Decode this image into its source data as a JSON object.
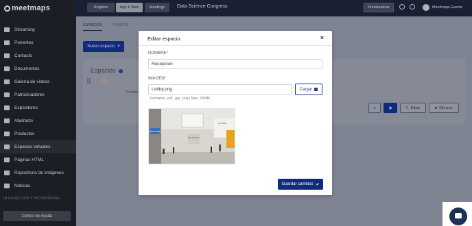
{
  "sidebar": {
    "logo": "meetmaps",
    "items": [
      {
        "label": "Streaming",
        "icon": "monitor-icon"
      },
      {
        "label": "Ponentes",
        "icon": "microphone-icon"
      },
      {
        "label": "Contacto",
        "icon": "phone-icon"
      },
      {
        "label": "Documentos",
        "icon": "paperclip-icon"
      },
      {
        "label": "Galería de vídeos",
        "icon": "video-icon"
      },
      {
        "label": "Patrocinadores",
        "icon": "megaphone-icon"
      },
      {
        "label": "Expositores",
        "icon": "store-icon"
      },
      {
        "label": "Abstracts",
        "icon": "book-icon"
      },
      {
        "label": "Productos",
        "icon": "box-icon"
      },
      {
        "label": "Espacios virtuales",
        "icon": "map-icon"
      },
      {
        "label": "Páginas HTML",
        "icon": "code-icon"
      },
      {
        "label": "Repositorio de imágenes",
        "icon": "images-icon"
      },
      {
        "label": "Noticias",
        "icon": "news-icon"
      }
    ],
    "section_label": "INTERACCIÓN Y NETWORKING",
    "help_button": "Centro de Ayuda"
  },
  "topbar": {
    "tabs": [
      "Registro",
      "App & Web",
      "Meetings"
    ],
    "active_tab": "App & Web",
    "event_name": "Data Science Congress",
    "preview_button": "Previsualizar",
    "account_name": "Meetmaps Events"
  },
  "main": {
    "tabs": [
      "ESPACIOS",
      "PUNTOS"
    ],
    "active_tab": "ESPACIOS",
    "new_space_button": "Nuevo espacio",
    "section_title": "Espacios",
    "points_header": "Puntos",
    "row_actions": {
      "edit": "Editar",
      "delete": "Eliminar"
    }
  },
  "modal": {
    "title": "Editar espacio",
    "name_label": "NOMBRE*",
    "name_value": "Recepcion",
    "image_label": "IMAGEN*",
    "image_value": "Lobby.png",
    "upload_button": "Cargar",
    "formats_hint": "Formatos: .pdf, .jpg, .png | Max. 200Mb",
    "save_button": "Guardar cambios",
    "preview_signs": {
      "welcome": "WELCOME",
      "gold_hall": "GOLD HALL",
      "lounge": "LOUNGE"
    }
  },
  "colors": {
    "primary": "#102a7e",
    "sidebar_bg": "#2b2f3a",
    "topbar_bg": "#1c2438",
    "overlay_bg": "#7e8491"
  }
}
